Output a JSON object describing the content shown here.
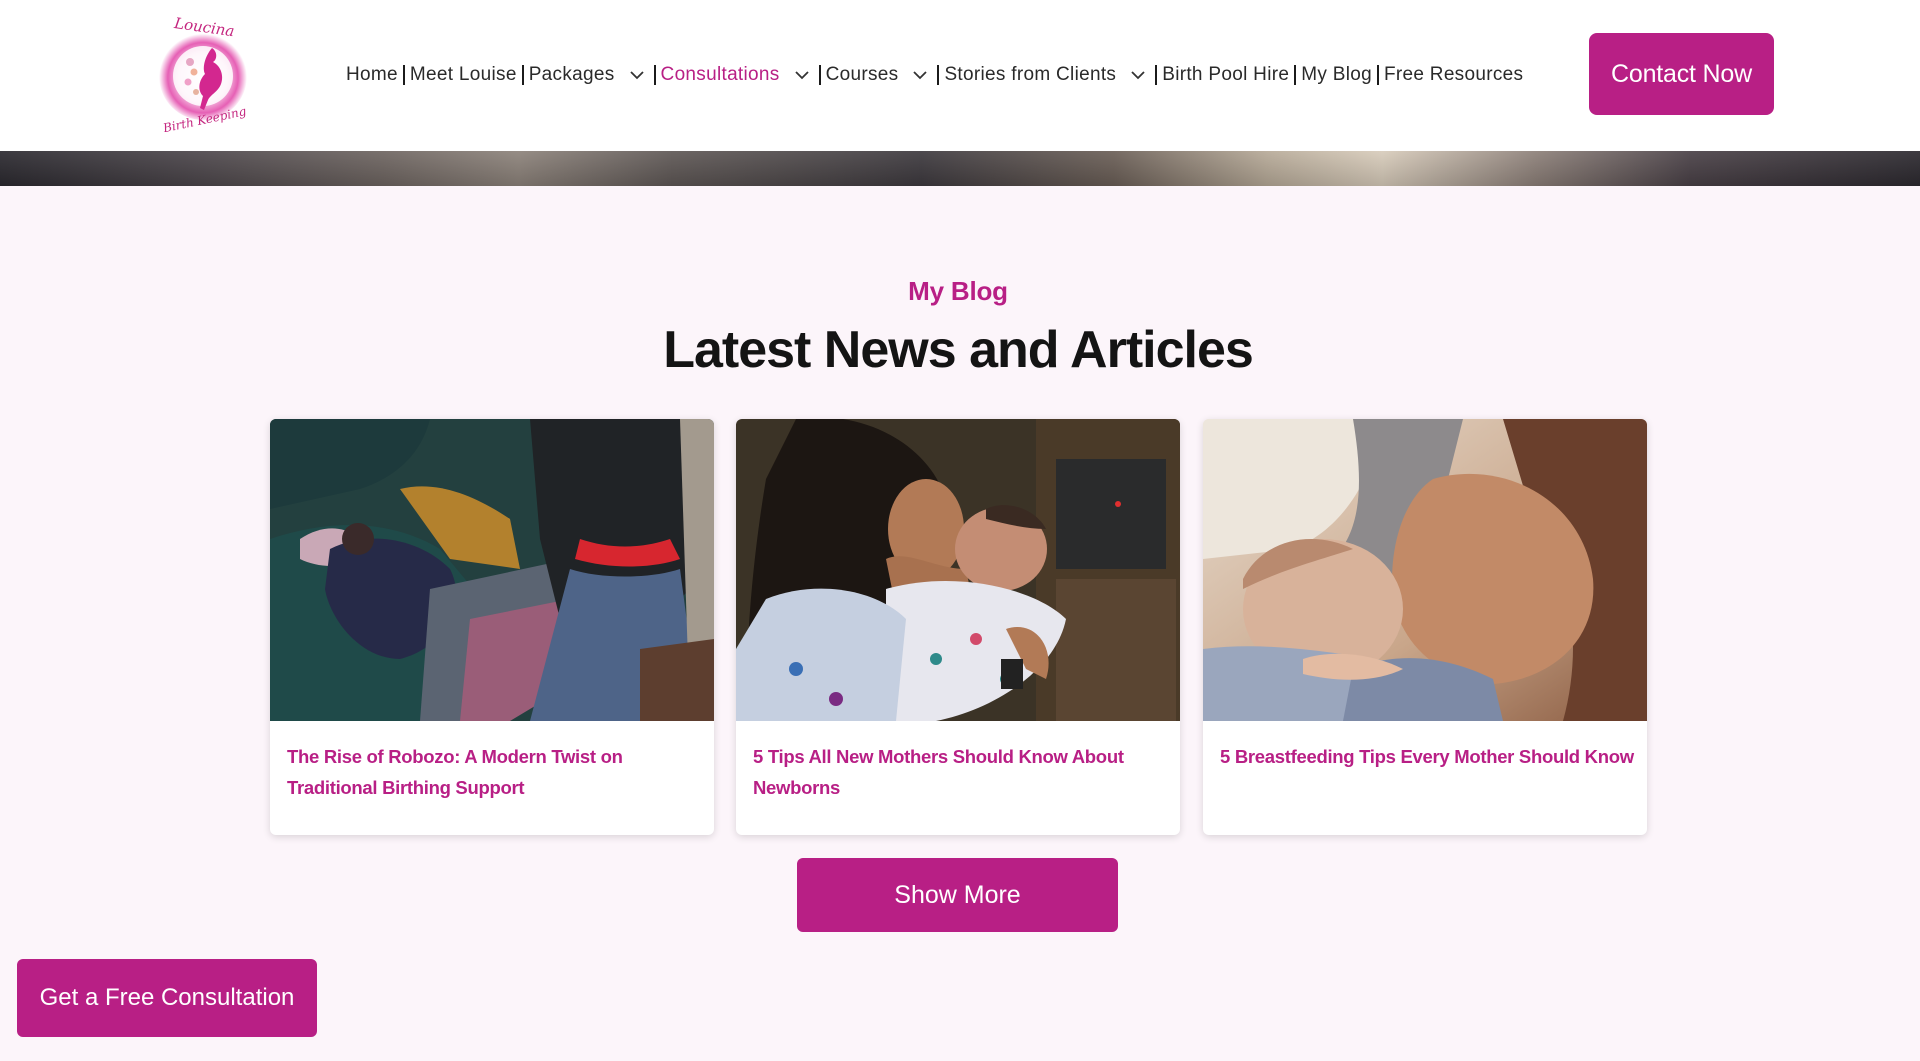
{
  "brand": {
    "logo_text_top": "Loucina",
    "logo_text_bottom": "Birth Keeping",
    "accent_color": "#b81f85"
  },
  "nav": {
    "items": [
      {
        "label": "Home",
        "has_dropdown": false,
        "active": false
      },
      {
        "label": "Meet Louise",
        "has_dropdown": false,
        "active": false
      },
      {
        "label": "Packages",
        "has_dropdown": true,
        "active": false
      },
      {
        "label": "Consultations",
        "has_dropdown": true,
        "active": true
      },
      {
        "label": "Courses",
        "has_dropdown": true,
        "active": false
      },
      {
        "label": "Stories from Clients",
        "has_dropdown": true,
        "active": false
      },
      {
        "label": "Birth Pool Hire",
        "has_dropdown": false,
        "active": false
      },
      {
        "label": "My Blog",
        "has_dropdown": false,
        "active": false
      },
      {
        "label": "Free Resources",
        "has_dropdown": false,
        "active": false
      }
    ],
    "contact_button": "Contact Now"
  },
  "blog": {
    "eyebrow": "My Blog",
    "title": "Latest News and Articles",
    "cards": [
      {
        "title": "The Rise of Robozo: A Modern Twist on Traditional Birthing Support",
        "image_icon": "rebozo-photo"
      },
      {
        "title": "5 Tips All New Mothers Should Know About Newborns",
        "image_icon": "mother-newborn-photo"
      },
      {
        "title": "5 Breastfeeding Tips Every Mother Should Know",
        "image_icon": "breastfeeding-photo"
      }
    ],
    "show_more": "Show More"
  },
  "floating_cta": "Get a Free Consultation"
}
